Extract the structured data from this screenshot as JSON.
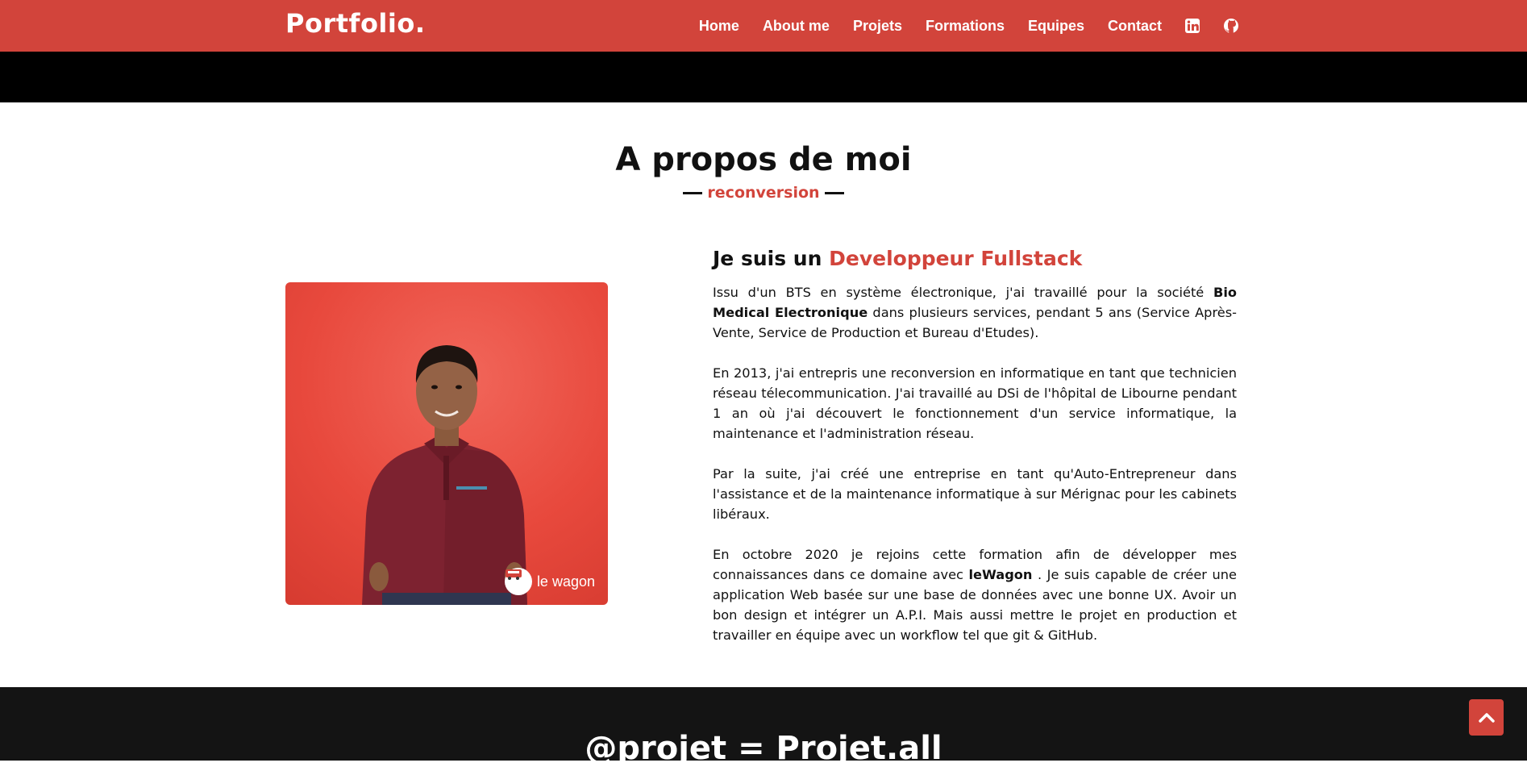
{
  "navbar": {
    "brand": "Portfolio.",
    "links": [
      "Home",
      "About me",
      "Projets",
      "Formations",
      "Equipes",
      "Contact"
    ],
    "icons": [
      "linkedin-icon",
      "github-icon"
    ],
    "bg_color": "#d2443b"
  },
  "about": {
    "title": "A propos de moi",
    "subtitle": "reconversion",
    "heading_prefix": "Je suis un",
    "heading_accent": "Developpeur Fullstack",
    "photo_badge": "le wagon",
    "p1": {
      "a": "Issu d'un BTS en système électronique, j'ai travaillé pour la société ",
      "b": "Bio Medical Electronique",
      "c": " dans plusieurs services, pendant 5 ans (Service Après-Vente, Service de Production et Bureau d'Etudes)."
    },
    "p2": "En 2013, j'ai entrepris une reconversion en informatique en tant que technicien réseau télecommunication. J'ai travaillé au DSi de l'hôpital de Libourne pendant 1 an où j'ai découvert le fonctionnement d'un service informatique, la maintenance et l'administration réseau.",
    "p3": "Par la suite, j'ai créé une entreprise en tant qu'Auto-Entrepreneur dans l'assistance et de la maintenance informatique à sur Mérignac pour les cabinets libéraux.",
    "p4": {
      "a": "En octobre 2020 je rejoins cette formation afin de développer mes connaissances dans ce domaine avec ",
      "b": "leWagon",
      "c": " . Je suis capable de créer une application Web basée sur une base de données avec une bonne UX. Avoir un bon design et intégrer un A.P.I. Mais aussi mettre le projet en production et travailler en équipe avec un workflow tel que git & GitHub."
    }
  },
  "projects": {
    "title": "@projet = Projet.all"
  },
  "colors": {
    "accent": "#d2443b",
    "dark": "#141414"
  }
}
